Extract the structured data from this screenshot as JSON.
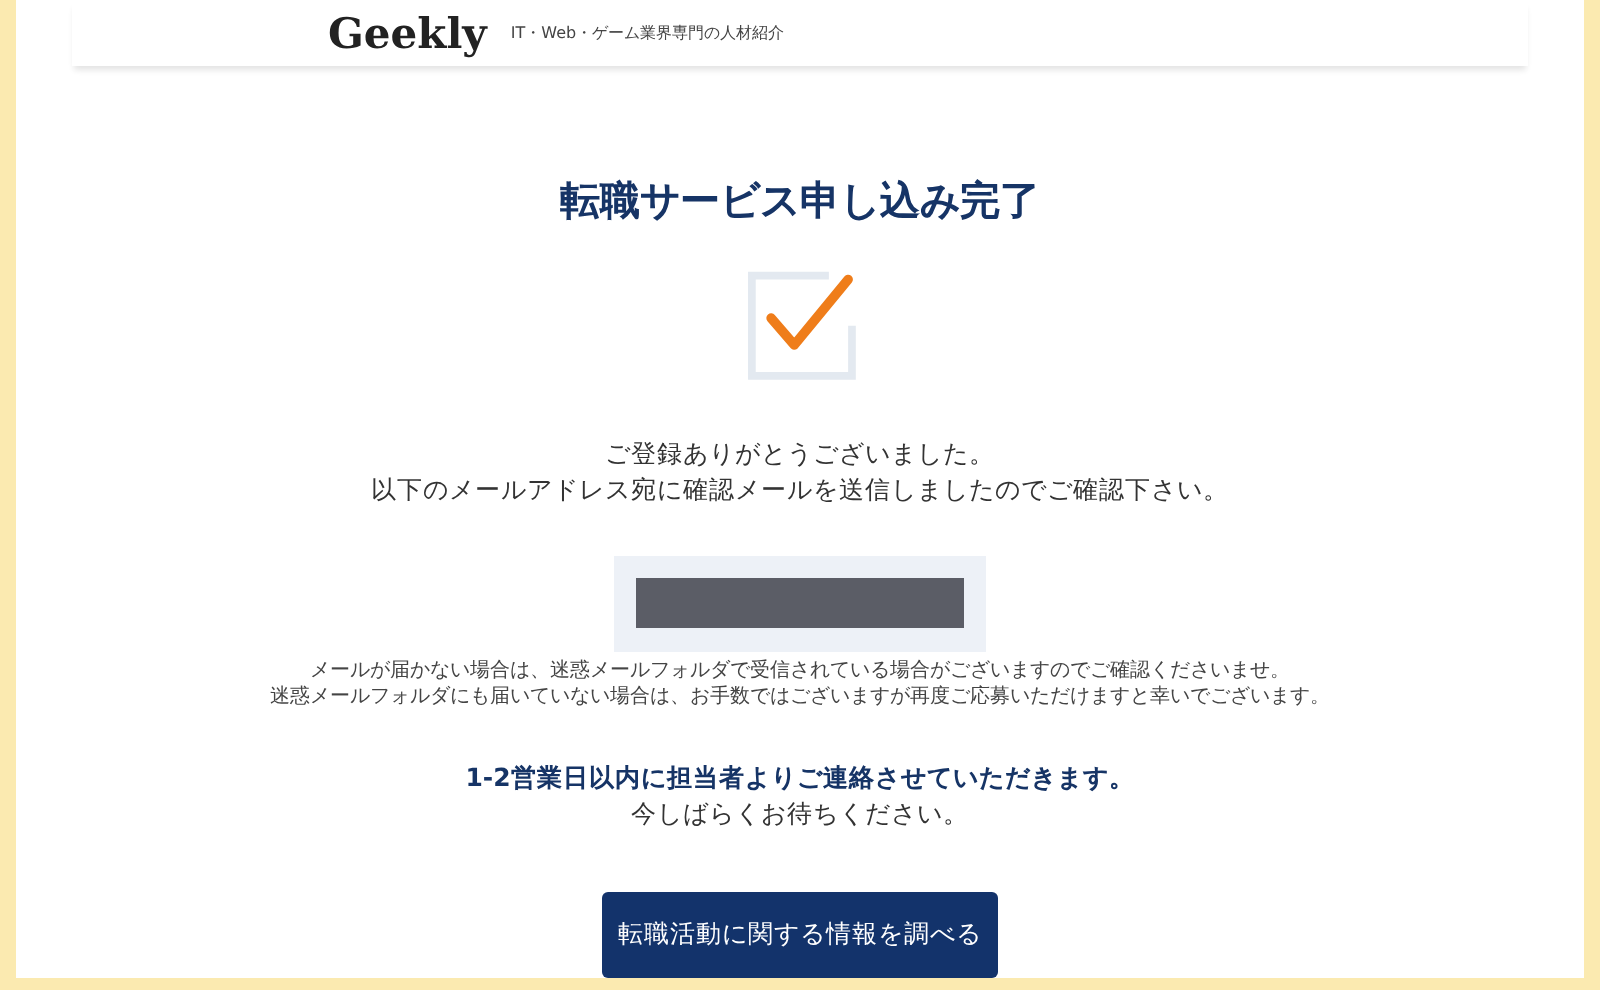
{
  "header": {
    "logo": "Geekly",
    "tagline": "IT・Web・ゲーム業界専門の人材紹介"
  },
  "title": "転職サービス申し込み完了",
  "message": [
    "ご登録ありがとうございました。",
    "以下のメールアドレス宛に確認メールを送信しましたのでご確認下さい。"
  ],
  "email": {
    "kind": "redacted"
  },
  "notes": [
    "メールが届かない場合は、迷惑メールフォルダで受信されている場合がございますのでご確認くださいませ。",
    "迷惑メールフォルダにも届いていない場合は、お手数ではございますが再度ご応募いただけますと幸いでございます。"
  ],
  "contact": {
    "emphasis": "1-2営業日以内に担当者よりご連絡させていただきます。",
    "followup": "今しばらくお待ちください。"
  },
  "button": "転職活動に関する情報を調べる"
}
